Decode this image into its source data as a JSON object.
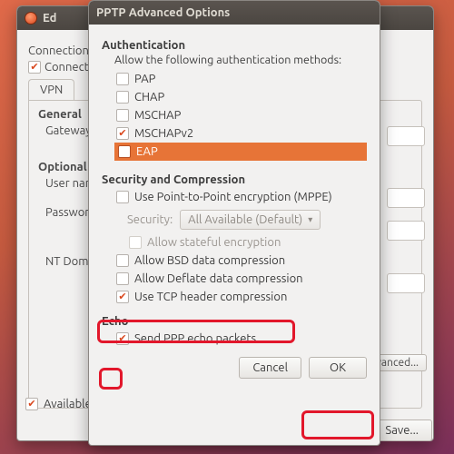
{
  "bg": {
    "title": "Ed",
    "conn_label": "Connection name:",
    "connect_row": "Connect automatically",
    "tab": "VPN",
    "section_general": "General",
    "gateway_label": "Gateway:",
    "section_optional": "Optional",
    "username_label": "User name:",
    "password_label": "Password:",
    "nt_label": "NT Domain:",
    "advanced_btn": "Advanced...",
    "available": "Available to all users",
    "save_btn": "Save..."
  },
  "modal": {
    "title": "PPTP Advanced Options",
    "auth_head": "Authentication",
    "auth_sub": "Allow the following authentication methods:",
    "methods": {
      "pap": "PAP",
      "chap": "CHAP",
      "mschap": "MSCHAP",
      "mschapv2": "MSCHAPv2",
      "eap": "EAP"
    },
    "sec_head": "Security and Compression",
    "mppe": "Use Point-to-Point encryption (MPPE)",
    "security_label": "Security:",
    "security_value": "All Available (Default)",
    "stateful": "Allow stateful encryption",
    "bsd": "Allow BSD data compression",
    "deflate": "Allow Deflate data compression",
    "tcp": "Use TCP header compression",
    "echo_head": "Echo",
    "echo_opt": "Send PPP echo packets",
    "cancel": "Cancel",
    "ok": "OK"
  }
}
